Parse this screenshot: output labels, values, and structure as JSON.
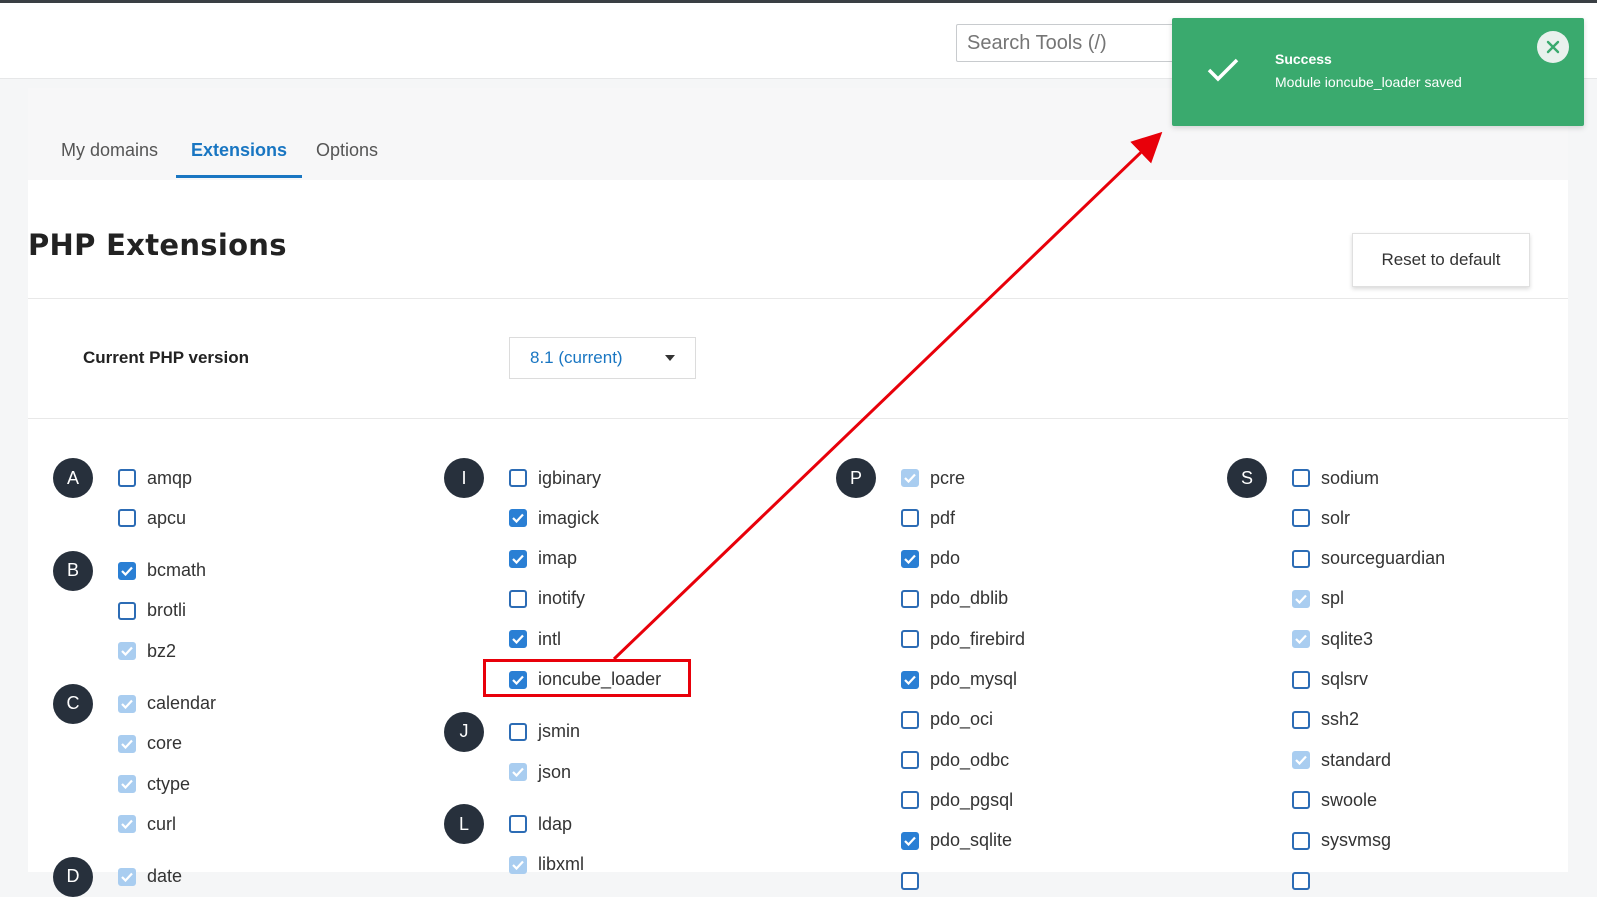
{
  "header": {
    "search_placeholder": "Search Tools (/)"
  },
  "tabs": [
    {
      "label": "My domains",
      "active": false
    },
    {
      "label": "Extensions",
      "active": true
    },
    {
      "label": "Options",
      "active": false
    }
  ],
  "page": {
    "title": "PHP Extensions",
    "reset_label": "Reset to default",
    "php_version_label": "Current PHP version",
    "php_version_value": "8.1 (current)"
  },
  "toast": {
    "title": "Success",
    "message": "Module ioncube_loader saved",
    "color": "#3aaa6e"
  },
  "highlighted_extension": "ioncube_loader",
  "extension_columns": [
    {
      "groups": [
        {
          "letter": "A",
          "items": [
            {
              "name": "amqp",
              "state": "unchecked"
            },
            {
              "name": "apcu",
              "state": "unchecked"
            }
          ]
        },
        {
          "letter": "B",
          "items": [
            {
              "name": "bcmath",
              "state": "checked"
            },
            {
              "name": "brotli",
              "state": "unchecked"
            },
            {
              "name": "bz2",
              "state": "disabled"
            }
          ]
        },
        {
          "letter": "C",
          "items": [
            {
              "name": "calendar",
              "state": "disabled"
            },
            {
              "name": "core",
              "state": "disabled"
            },
            {
              "name": "ctype",
              "state": "disabled"
            },
            {
              "name": "curl",
              "state": "disabled"
            }
          ]
        },
        {
          "letter": "D",
          "items": [
            {
              "name": "date",
              "state": "disabled"
            }
          ]
        }
      ]
    },
    {
      "groups": [
        {
          "letter": "I",
          "items": [
            {
              "name": "igbinary",
              "state": "unchecked"
            },
            {
              "name": "imagick",
              "state": "checked"
            },
            {
              "name": "imap",
              "state": "checked"
            },
            {
              "name": "inotify",
              "state": "unchecked"
            },
            {
              "name": "intl",
              "state": "checked"
            },
            {
              "name": "ioncube_loader",
              "state": "checked"
            }
          ]
        },
        {
          "letter": "J",
          "items": [
            {
              "name": "jsmin",
              "state": "unchecked"
            },
            {
              "name": "json",
              "state": "disabled"
            }
          ]
        },
        {
          "letter": "L",
          "items": [
            {
              "name": "ldap",
              "state": "unchecked"
            },
            {
              "name": "libxml",
              "state": "disabled"
            }
          ]
        }
      ]
    },
    {
      "groups": [
        {
          "letter": "P",
          "items": [
            {
              "name": "pcre",
              "state": "disabled"
            },
            {
              "name": "pdf",
              "state": "unchecked"
            },
            {
              "name": "pdo",
              "state": "checked"
            },
            {
              "name": "pdo_dblib",
              "state": "unchecked"
            },
            {
              "name": "pdo_firebird",
              "state": "unchecked"
            },
            {
              "name": "pdo_mysql",
              "state": "checked"
            },
            {
              "name": "pdo_oci",
              "state": "unchecked"
            },
            {
              "name": "pdo_odbc",
              "state": "unchecked"
            },
            {
              "name": "pdo_pgsql",
              "state": "unchecked"
            },
            {
              "name": "pdo_sqlite",
              "state": "checked"
            },
            {
              "name": "",
              "state": "unchecked"
            }
          ]
        }
      ]
    },
    {
      "groups": [
        {
          "letter": "S",
          "items": [
            {
              "name": "sodium",
              "state": "unchecked"
            },
            {
              "name": "solr",
              "state": "unchecked"
            },
            {
              "name": "sourceguardian",
              "state": "unchecked"
            },
            {
              "name": "spl",
              "state": "disabled"
            },
            {
              "name": "sqlite3",
              "state": "disabled"
            },
            {
              "name": "sqlsrv",
              "state": "unchecked"
            },
            {
              "name": "ssh2",
              "state": "unchecked"
            },
            {
              "name": "standard",
              "state": "disabled"
            },
            {
              "name": "swoole",
              "state": "unchecked"
            },
            {
              "name": "sysvmsg",
              "state": "unchecked"
            },
            {
              "name": "",
              "state": "unchecked"
            }
          ]
        }
      ]
    }
  ]
}
